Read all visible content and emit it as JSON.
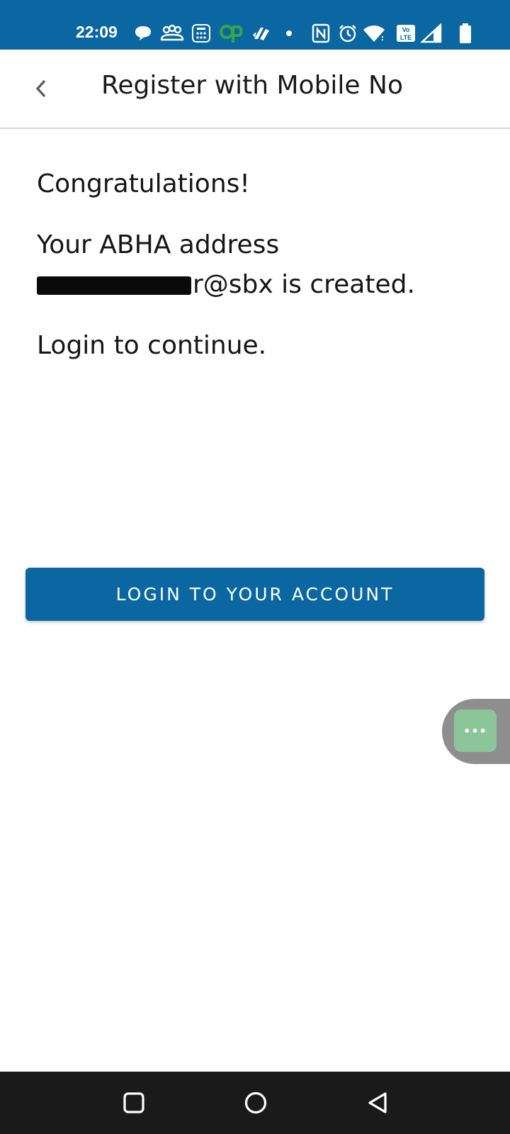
{
  "status_bar": {
    "time": "22:09",
    "icons": [
      "chat-bubble-icon",
      "people-icon",
      "calculator-icon",
      "p-app-icon",
      "phonepe-icon",
      "dot-icon",
      "nfc-icon",
      "alarm-icon",
      "wifi-icon",
      "volte-icon",
      "signal-icon",
      "battery-icon"
    ]
  },
  "app_bar": {
    "title": "Register with Mobile No",
    "back_icon": "chevron-left-icon"
  },
  "content": {
    "congrats": "Congratulations!",
    "abha_prefix": "Your ABHA address",
    "abha_suffix": "r@sbx is created.",
    "login_msg": "Login to continue."
  },
  "login_button": {
    "label": "LOGIN TO YOUR ACCOUNT"
  },
  "chat_widget": {
    "icon": "ellipsis-icon",
    "dots": "•••"
  },
  "nav_bar": {
    "icons": [
      "recents-square-icon",
      "home-circle-icon",
      "back-triangle-icon"
    ]
  },
  "colors": {
    "primary": "#0b67a1",
    "chat_green": "#8cc59a",
    "chat_tab_gray": "#8e8e8e",
    "nav_bar": "#1a1a1a"
  }
}
